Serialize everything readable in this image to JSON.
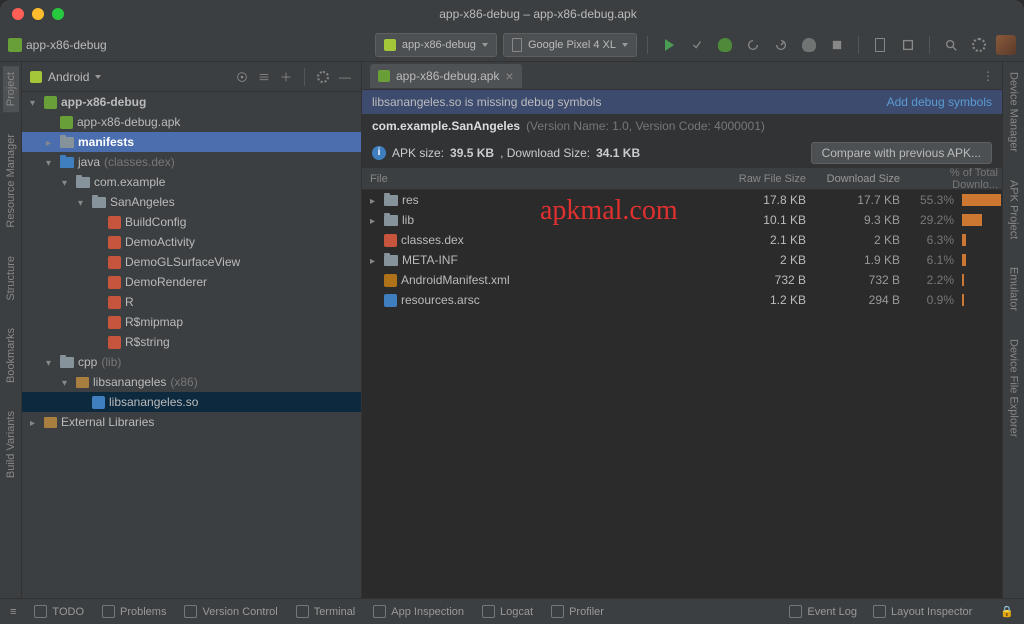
{
  "window": {
    "title": "app-x86-debug – app-x86-debug.apk"
  },
  "breadcrumb": {
    "root": "app-x86-debug"
  },
  "toolbar": {
    "run_config": "app-x86-debug",
    "device": "Google Pixel 4 XL"
  },
  "left_gutter": [
    "Project",
    "Resource Manager",
    "Structure",
    "Bookmarks",
    "Build Variants"
  ],
  "right_gutter": [
    "Device Manager",
    "APK Project",
    "Emulator",
    "Device File Explorer"
  ],
  "sidebar": {
    "scope": "Android",
    "tree": [
      {
        "indent": 0,
        "arrow": "exp",
        "icon": "apk",
        "label": "app-x86-debug",
        "bold": true
      },
      {
        "indent": 1,
        "arrow": "none",
        "icon": "apk",
        "label": "app-x86-debug.apk"
      },
      {
        "indent": 1,
        "arrow": "col",
        "icon": "folder",
        "label": "manifests",
        "sel": true,
        "bold": true
      },
      {
        "indent": 1,
        "arrow": "exp",
        "icon": "folder-blue",
        "label": "java",
        "suffix": "(classes.dex)"
      },
      {
        "indent": 2,
        "arrow": "exp",
        "icon": "folder",
        "label": "com.example"
      },
      {
        "indent": 3,
        "arrow": "exp",
        "icon": "folder",
        "label": "SanAngeles"
      },
      {
        "indent": 4,
        "arrow": "none",
        "icon": "class",
        "label": "BuildConfig"
      },
      {
        "indent": 4,
        "arrow": "none",
        "icon": "class",
        "label": "DemoActivity"
      },
      {
        "indent": 4,
        "arrow": "none",
        "icon": "class",
        "label": "DemoGLSurfaceView"
      },
      {
        "indent": 4,
        "arrow": "none",
        "icon": "class",
        "label": "DemoRenderer"
      },
      {
        "indent": 4,
        "arrow": "none",
        "icon": "class",
        "label": "R"
      },
      {
        "indent": 4,
        "arrow": "none",
        "icon": "class",
        "label": "R$mipmap"
      },
      {
        "indent": 4,
        "arrow": "none",
        "icon": "class",
        "label": "R$string"
      },
      {
        "indent": 1,
        "arrow": "exp",
        "icon": "folder",
        "label": "cpp",
        "suffix": "(lib)"
      },
      {
        "indent": 2,
        "arrow": "exp",
        "icon": "lib",
        "label": "libsanangeles",
        "suffix": "(x86)"
      },
      {
        "indent": 3,
        "arrow": "none",
        "icon": "so",
        "label": "libsanangeles.so",
        "hi": true
      },
      {
        "indent": 0,
        "arrow": "col",
        "icon": "lib",
        "label": "External Libraries"
      }
    ]
  },
  "editor": {
    "tab": "app-x86-debug.apk",
    "warning": "libsanangeles.so is missing debug symbols",
    "warning_action": "Add debug symbols",
    "package": "com.example.SanAngeles",
    "version_meta": "(Version Name: 1.0, Version Code: 4000001)",
    "size_prefix": "APK size:",
    "size_apk": "39.5 KB",
    "dl_prefix": ", Download Size:",
    "size_dl": "34.1 KB",
    "compare_btn": "Compare with previous APK...",
    "columns": {
      "file": "File",
      "raw": "Raw File Size",
      "dl": "Download Size",
      "pct": "% of Total Downlo..."
    },
    "rows": [
      {
        "arrow": "col",
        "icon": "folder",
        "name": "res",
        "raw": "17.8 KB",
        "dl": "17.7 KB",
        "pct": "55.3%",
        "bar": 55
      },
      {
        "arrow": "col",
        "icon": "folder",
        "name": "lib",
        "raw": "10.1 KB",
        "dl": "9.3 KB",
        "pct": "29.2%",
        "bar": 29
      },
      {
        "arrow": "none",
        "icon": "class",
        "name": "classes.dex",
        "raw": "2.1 KB",
        "dl": "2 KB",
        "pct": "6.3%",
        "bar": 6
      },
      {
        "arrow": "col",
        "icon": "folder",
        "name": "META-INF",
        "raw": "2 KB",
        "dl": "1.9 KB",
        "pct": "6.1%",
        "bar": 6
      },
      {
        "arrow": "none",
        "icon": "xml",
        "name": "AndroidManifest.xml",
        "raw": "732 B",
        "dl": "732 B",
        "pct": "2.2%",
        "bar": 3
      },
      {
        "arrow": "none",
        "icon": "arsc",
        "name": "resources.arsc",
        "raw": "1.2 KB",
        "dl": "294 B",
        "pct": "0.9%",
        "bar": 2
      }
    ]
  },
  "watermark": "apkmal.com",
  "statusbar": {
    "items": [
      "TODO",
      "Problems",
      "Version Control",
      "Terminal",
      "App Inspection",
      "Logcat",
      "Profiler"
    ],
    "right": [
      "Event Log",
      "Layout Inspector"
    ]
  }
}
